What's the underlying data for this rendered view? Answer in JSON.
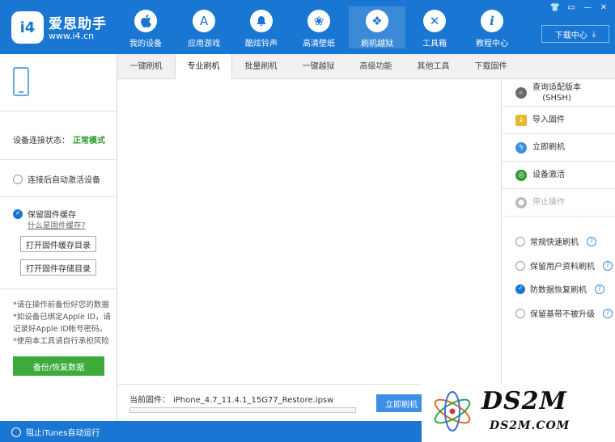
{
  "window": {
    "controls": [
      "👕",
      "▭",
      "—",
      "✕"
    ],
    "download_center": "下载中心"
  },
  "brand": {
    "logo_text": "i4",
    "name": "爱思助手",
    "url": "www.i4.cn"
  },
  "nav": [
    {
      "label": "我的设备",
      "icon": "apple-icon",
      "glyph": ""
    },
    {
      "label": "应用游戏",
      "icon": "app-store-icon",
      "glyph": "A"
    },
    {
      "label": "酷炫铃声",
      "icon": "bell-icon",
      "glyph": "🔔"
    },
    {
      "label": "高清壁纸",
      "icon": "flower-icon",
      "glyph": "❀"
    },
    {
      "label": "刷机越狱",
      "icon": "dropbox-icon",
      "glyph": "❖",
      "active": true
    },
    {
      "label": "工具箱",
      "icon": "tools-icon",
      "glyph": "✕"
    },
    {
      "label": "教程中心",
      "icon": "info-icon",
      "glyph": "i"
    }
  ],
  "left": {
    "status_label": "设备连接状态：",
    "status_value": "正常模式",
    "auto_activate": "连接后自动激活设备",
    "keep_cache": "保留固件缓存",
    "what_cache": "什么是固件缓存?",
    "open_cache_dir": "打开固件缓存目录",
    "open_storage_dir": "打开固件存储目录",
    "notes": [
      "*请在操作前备份好您的数据",
      "*如设备已绑定Apple ID，请记录好Apple ID帐号密码。",
      "*使用本工具请自行承担风险"
    ],
    "backup_button": "备份/恢复数据"
  },
  "tabs": [
    "一键刷机",
    "专业刷机",
    "批量刷机",
    "一键越狱",
    "高级功能",
    "其他工具",
    "下载固件"
  ],
  "active_tab": 1,
  "center": {
    "firmware_label": "当前固件：",
    "firmware_value": "iPhone_4.7_11.4.1_15G77_Restore.ipsw",
    "progress": 0,
    "flash_button": "立即刷机"
  },
  "right": {
    "actions": [
      {
        "label": "查询适配版本\n(SHSH)",
        "icon": "search-icon",
        "color": "#6a6a6a",
        "glyph": "⌕"
      },
      {
        "label": "导入固件",
        "icon": "folder-icon",
        "color": "#e8b730",
        "glyph": "↓"
      },
      {
        "label": "立即刷机",
        "icon": "flash-icon",
        "color": "#3d8ee6",
        "glyph": "ϟ"
      },
      {
        "label": "设备激活",
        "icon": "globe-icon",
        "color": "#2e9b2e",
        "glyph": "◎"
      },
      {
        "label": "停止操作",
        "icon": "stop-icon",
        "color": "#bbbbbb",
        "glyph": "●",
        "disabled": true
      }
    ],
    "options": [
      {
        "label": "常规快速刷机",
        "checked": false
      },
      {
        "label": "保留用户资料刷机",
        "checked": false
      },
      {
        "label": "防数据恢复刷机",
        "checked": true
      },
      {
        "label": "保留基带不被升级",
        "checked": false
      }
    ]
  },
  "footer": {
    "itunes": "阻止iTunes自动运行"
  },
  "watermark": {
    "big": "DS2M",
    "small": "DS2M.COM"
  },
  "colors": {
    "brand_blue": "#1976d2",
    "status_green": "#2e9b2e",
    "button_green": "#3cab3c"
  }
}
